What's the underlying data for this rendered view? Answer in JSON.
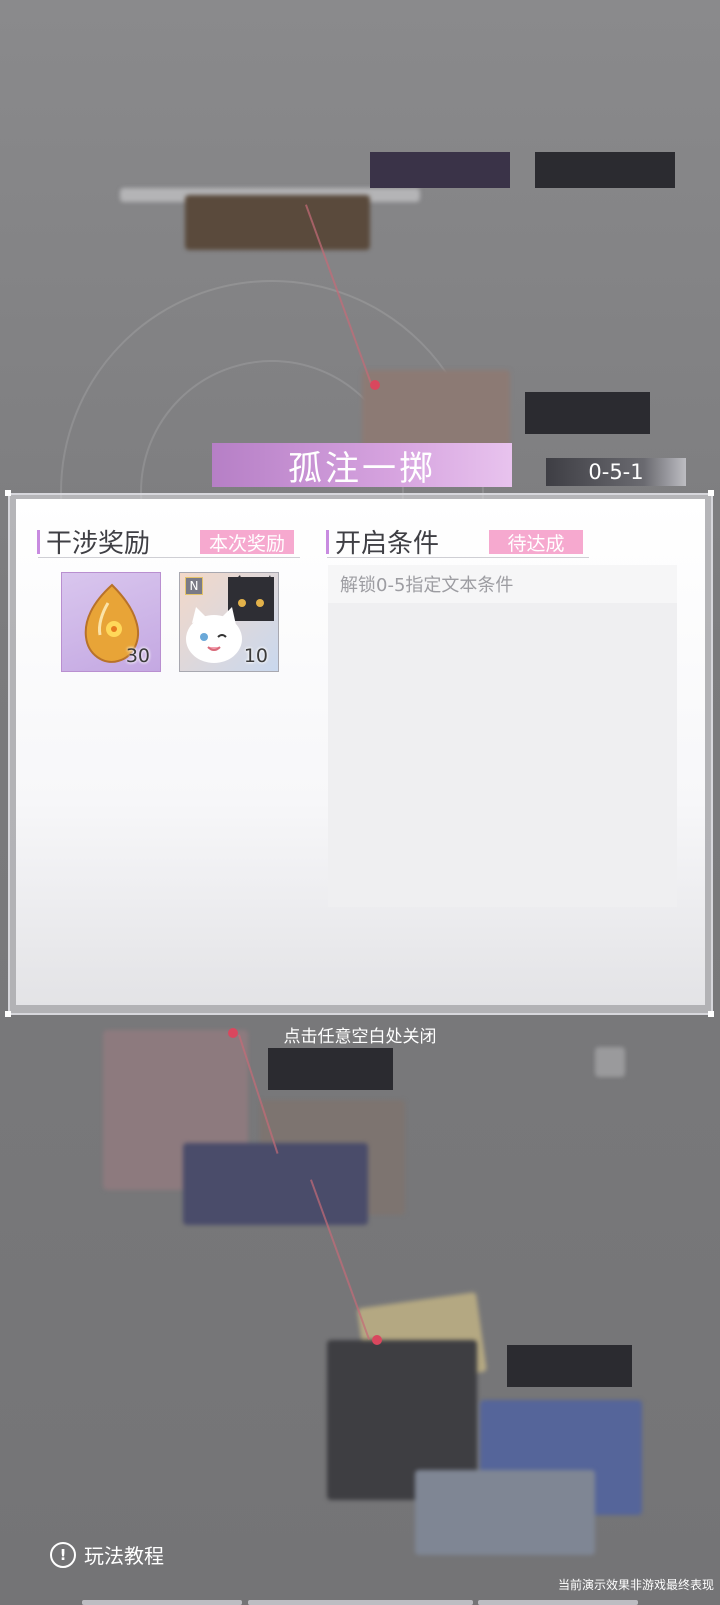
{
  "stage": {
    "title": "孤注一掷",
    "code": "0-5-1"
  },
  "reward_section": {
    "title": "干涉奖励",
    "tag": "本次奖励",
    "items": [
      {
        "name": "amber-gem",
        "count": "30"
      },
      {
        "name": "cat-card",
        "count": "10",
        "badge": "N"
      }
    ]
  },
  "condition_section": {
    "title": "开启条件",
    "tag": "待达成",
    "conditions": [
      "解锁0-5指定文本条件"
    ]
  },
  "close_hint": "点击任意空白处关闭",
  "tutorial_label": "玩法教程",
  "disclaimer": "当前演示效果非游戏最终表现",
  "colors": {
    "accent_purple": "#c88be0",
    "tag_pink": "#f6a9cf",
    "overlay_gray": "#7a7a7c"
  }
}
